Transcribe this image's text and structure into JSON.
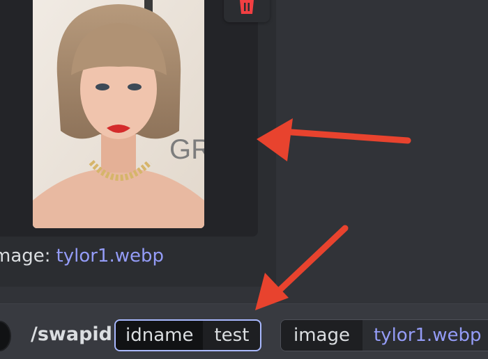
{
  "attachment": {
    "filename_label": "mage:",
    "filename_value": "tylor1.webp"
  },
  "composer": {
    "command": "/swapid",
    "options": [
      {
        "key": "idname",
        "value": "test"
      },
      {
        "key": "image",
        "value": "tylor1.webp"
      }
    ]
  },
  "colors": {
    "background": "#313338",
    "card": "#2b2d31",
    "link": "#949cf7",
    "text": "#dbdee1",
    "danger": "#f23f42",
    "active_outline": "#a9b9ff",
    "annotation_arrow": "#e8432e"
  },
  "icons": {
    "delete": "trash-icon",
    "annotation": "arrow-annotation"
  }
}
